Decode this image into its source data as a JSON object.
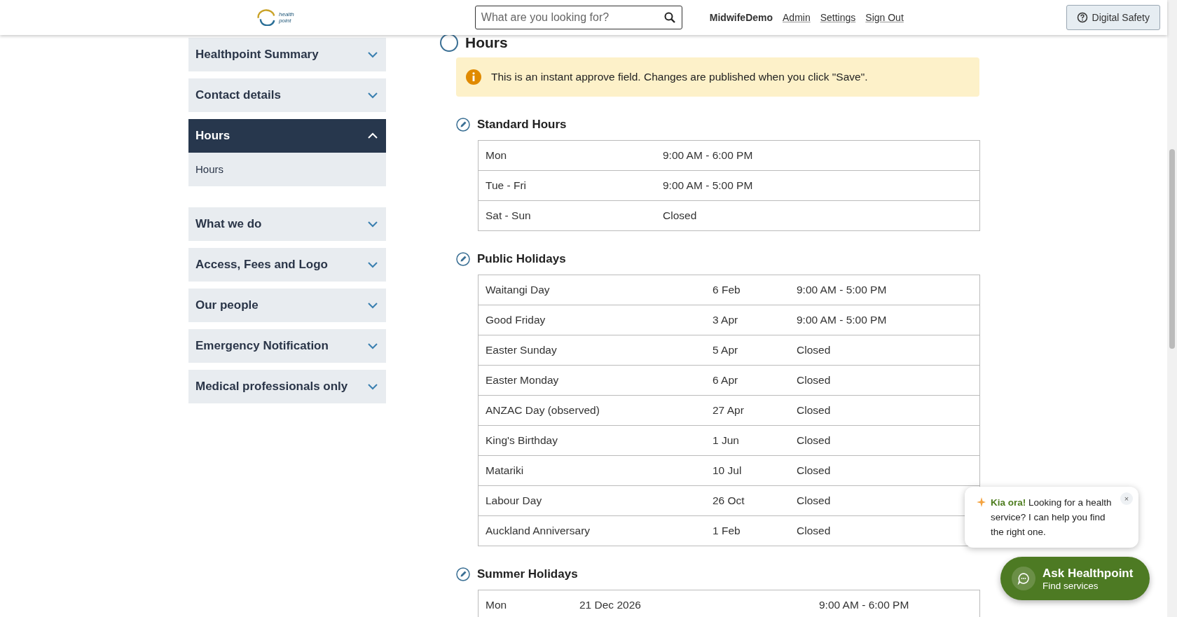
{
  "header": {
    "logo": [
      "health",
      "point"
    ],
    "search": {
      "placeholder": "What are you looking for?"
    },
    "user": "MidwifeDemo",
    "links": [
      "Admin",
      "Settings",
      "Sign Out"
    ],
    "safety_button": "Digital Safety"
  },
  "sidebar": [
    {
      "label": "Healthpoint Summary",
      "expanded": false
    },
    {
      "label": "Contact details",
      "expanded": false
    },
    {
      "label": "Hours",
      "expanded": true,
      "children": [
        "Hours"
      ]
    },
    {
      "label": "What we do",
      "expanded": false
    },
    {
      "label": "Access, Fees and Logo",
      "expanded": false
    },
    {
      "label": "Our people",
      "expanded": false
    },
    {
      "label": "Emergency Notification",
      "expanded": false
    },
    {
      "label": "Medical professionals only",
      "expanded": false
    }
  ],
  "page_title": "Hours",
  "notice": "This is an instant approve field. Changes are published when you click \"Save\".",
  "sections": [
    {
      "title": "Standard Hours",
      "rows": [
        [
          "Mon",
          "9:00 AM - 6:00 PM"
        ],
        [
          "Tue - Fri",
          "9:00 AM - 5:00 PM"
        ],
        [
          "Sat - Sun",
          "Closed"
        ]
      ]
    },
    {
      "title": "Public Holidays",
      "rows": [
        [
          "Waitangi Day",
          "6 Feb",
          "9:00 AM - 5:00 PM"
        ],
        [
          "Good Friday",
          "3 Apr",
          "9:00 AM - 5:00 PM"
        ],
        [
          "Easter Sunday",
          "5 Apr",
          "Closed"
        ],
        [
          "Easter Monday",
          "6 Apr",
          "Closed"
        ],
        [
          "ANZAC Day (observed)",
          "27 Apr",
          "Closed"
        ],
        [
          "King's Birthday",
          "1 Jun",
          "Closed"
        ],
        [
          "Matariki",
          "10 Jul",
          "Closed"
        ],
        [
          "Labour Day",
          "26 Oct",
          "Closed"
        ],
        [
          "Auckland Anniversary",
          "1 Feb",
          "Closed"
        ]
      ]
    },
    {
      "title": "Summer Holidays",
      "rows": [
        [
          "Mon",
          "21 Dec 2026",
          "9:00 AM - 6:00 PM"
        ]
      ]
    }
  ],
  "chat": {
    "message": "**Kia ora!** Looking for a health service? I can help you find the right one.",
    "close": "×",
    "title": "Ask Healthpoint",
    "subtitle": "Find services"
  }
}
